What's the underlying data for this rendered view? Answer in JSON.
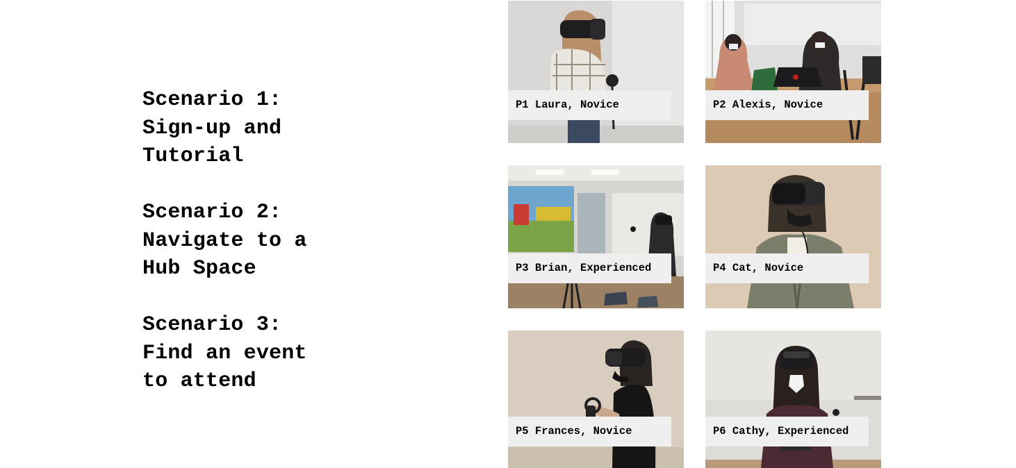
{
  "scenarios": [
    {
      "lines": [
        "Scenario 1:",
        "Sign-up and",
        "Tutorial"
      ]
    },
    {
      "lines": [
        "Scenario 2:",
        "Navigate to a",
        "Hub Space"
      ]
    },
    {
      "lines": [
        "Scenario 3:",
        "Find an event",
        "to attend"
      ]
    }
  ],
  "participants": [
    {
      "caption": "P1 Laura, Novice"
    },
    {
      "caption": "P2 Alexis, Novice"
    },
    {
      "caption": "P3 Brian, Experienced"
    },
    {
      "caption": "P4 Cat, Novice"
    },
    {
      "caption": "P5 Frances, Novice"
    },
    {
      "caption": "P6 Cathy, Experienced"
    }
  ]
}
